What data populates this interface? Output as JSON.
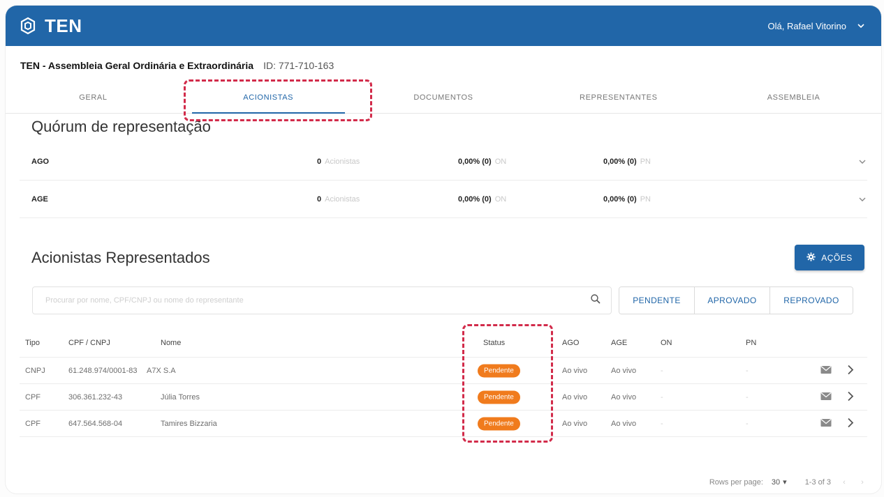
{
  "header": {
    "brand": "TEN",
    "greeting": "Olá, Rafael Vitorino"
  },
  "event": {
    "title": "TEN - Assembleia Geral Ordinária e Extraordinária",
    "id_text": "ID: 771-710-163"
  },
  "tabs": [
    {
      "label": "GERAL",
      "active": false
    },
    {
      "label": "ACIONISTAS",
      "active": true
    },
    {
      "label": "DOCUMENTOS",
      "active": false
    },
    {
      "label": "REPRESENTANTES",
      "active": false
    },
    {
      "label": "ASSEMBLEIA",
      "active": false
    }
  ],
  "quorum": {
    "heading": "Quórum de representação",
    "rows": [
      {
        "label": "AGO",
        "count": "0",
        "count_unit": "Acionistas",
        "on_value": "0,00% (0)",
        "on_unit": "ON",
        "pn_value": "0,00% (0)",
        "pn_unit": "PN"
      },
      {
        "label": "AGE",
        "count": "0",
        "count_unit": "Acionistas",
        "on_value": "0,00% (0)",
        "on_unit": "ON",
        "pn_value": "0,00% (0)",
        "pn_unit": "PN"
      }
    ]
  },
  "represented": {
    "heading": "Acionistas Representados",
    "actions_label": "AÇÕES",
    "search_placeholder": "Procurar por nome, CPF/CNPJ ou nome do representante",
    "filters": [
      "PENDENTE",
      "APROVADO",
      "REPROVADO"
    ],
    "columns": {
      "tipo": "Tipo",
      "cpf": "CPF / CNPJ",
      "nome": "Nome",
      "status": "Status",
      "ago": "AGO",
      "age": "AGE",
      "on": "ON",
      "pn": "PN"
    },
    "rows": [
      {
        "tipo": "CNPJ",
        "cpf": "61.248.974/0001-83",
        "nome": "A7X S.A",
        "status": "Pendente",
        "ago": "Ao vivo",
        "age": "Ao vivo",
        "on": "-",
        "pn": "-"
      },
      {
        "tipo": "CPF",
        "cpf": "306.361.232-43",
        "nome": "Júlia Torres",
        "status": "Pendente",
        "ago": "Ao vivo",
        "age": "Ao vivo",
        "on": "-",
        "pn": "-"
      },
      {
        "tipo": "CPF",
        "cpf": "647.564.568-04",
        "nome": "Tamires Bizzaria",
        "status": "Pendente",
        "ago": "Ao vivo",
        "age": "Ao vivo",
        "on": "-",
        "pn": "-"
      }
    ]
  },
  "pagination": {
    "rows_per_page_label": "Rows per page:",
    "rows_per_page_value": "30",
    "range": "1-3 of 3"
  },
  "colors": {
    "primary": "#2166a8",
    "status_pending": "#f07b1d",
    "highlight": "#d22b4a"
  },
  "icons": {
    "brand": "ten-logo-icon",
    "user_menu": "chevron-down-icon",
    "expand": "chevron-down-icon",
    "actions": "gear-icon",
    "search": "search-icon",
    "row_message": "mail-icon",
    "row_open": "chevron-right-icon",
    "pagination_prev": "chevron-left-icon",
    "pagination_next": "chevron-right-icon"
  }
}
